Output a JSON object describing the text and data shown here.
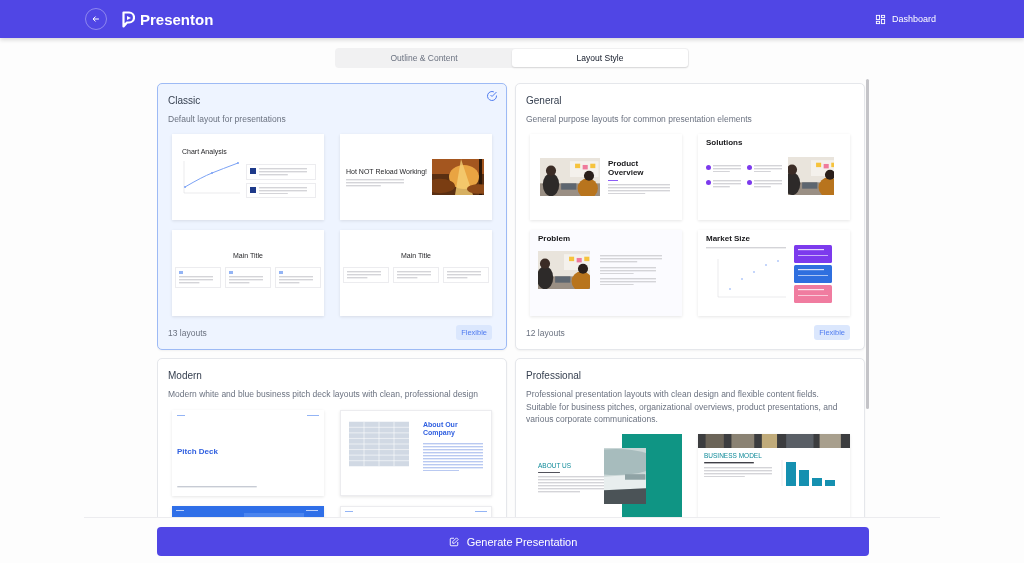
{
  "header": {
    "logo": "Presenton",
    "dashboard": "Dashboard"
  },
  "tabs": [
    {
      "label": "Outline & Content",
      "selected": false
    },
    {
      "label": "Layout Style",
      "selected": true
    }
  ],
  "layouts": [
    {
      "name": "Classic",
      "description": "Default layout for presentations",
      "selected": true,
      "count": "13 layouts",
      "badge": "Flexible",
      "slides": [
        {
          "kind": "chart",
          "title": "Chart Analysis"
        },
        {
          "kind": "picture-right",
          "title": "Hot NOT Reload Working!"
        },
        {
          "kind": "cards-numbered",
          "title": "Main Title"
        },
        {
          "kind": "cards",
          "title": "Main Title"
        }
      ]
    },
    {
      "name": "General",
      "description": "General purpose layouts for common presentation elements",
      "selected": false,
      "count": "12 layouts",
      "badge": "Flexible",
      "slides": [
        {
          "kind": "picture-left",
          "title": "Product Overview"
        },
        {
          "kind": "solutions",
          "title": "Solutions"
        },
        {
          "kind": "problem",
          "title": "Problem"
        },
        {
          "kind": "market",
          "title": "Market Size"
        }
      ]
    },
    {
      "name": "Modern",
      "description": "Modern white and blue business pitch deck layouts with clean, professional design",
      "selected": false,
      "slides": [
        {
          "kind": "pitch",
          "title": "Pitch Deck"
        },
        {
          "kind": "about-company",
          "title": "About Our Company"
        },
        {
          "kind": "banner"
        },
        {
          "kind": "plain"
        }
      ]
    },
    {
      "name": "Professional",
      "description": "Professional presentation layouts with clean design and flexible content fields. Suitable for business pitches, organizational overviews, product presentations, and various corporate communications.",
      "selected": false,
      "slides": [
        {
          "kind": "about-us",
          "title": "ABOUT US"
        },
        {
          "kind": "business",
          "title": "BUSINESS MODEL"
        }
      ]
    }
  ],
  "generate_button": "Generate Presentation"
}
